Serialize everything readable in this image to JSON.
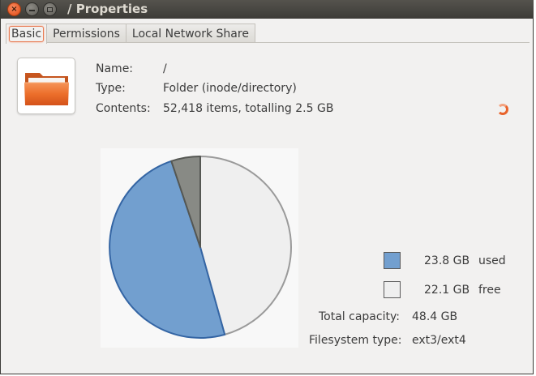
{
  "window": {
    "title": "/ Properties",
    "close_glyph": "×"
  },
  "tabs": [
    {
      "label": "Basic"
    },
    {
      "label": "Permissions"
    },
    {
      "label": "Local Network Share"
    }
  ],
  "info": {
    "name_label": "Name:",
    "name_value": "/",
    "type_label": "Type:",
    "type_value": "Folder (inode/directory)",
    "contents_label": "Contents:",
    "contents_value": "52,418 items, totalling 2.5 GB"
  },
  "icons": {
    "folder": "folder-icon",
    "spinner": "loading-spinner-icon"
  },
  "usage": {
    "used_value": "23.8 GB",
    "used_label": "used",
    "free_value": "22.1 GB",
    "free_label": "free",
    "capacity_label": "Total capacity:",
    "capacity_value": "48.4 GB",
    "fstype_label": "Filesystem type:",
    "fstype_value": "ext3/ext4"
  },
  "chart_data": {
    "type": "pie",
    "slices": [
      {
        "label": "free",
        "value_gb": 22.1,
        "color": "#efefef"
      },
      {
        "label": "used",
        "value_gb": 23.8,
        "color": "#729fcf"
      },
      {
        "label": "",
        "value_gb": 2.5,
        "color": "#888a85"
      }
    ]
  },
  "colors": {
    "used": "#729fcf",
    "free": "#efefef",
    "other": "#888a85",
    "accent": "#e8632b"
  }
}
